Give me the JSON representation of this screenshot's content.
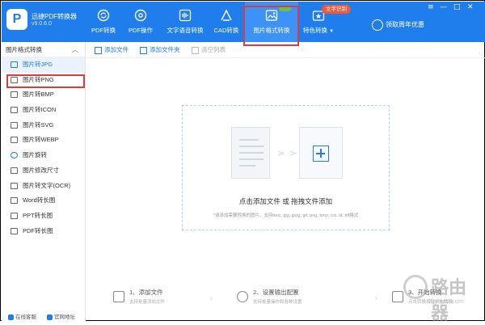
{
  "app": {
    "title": "迅捷PDF转换器",
    "version": "v9.0.6.0",
    "logo_letter": "P"
  },
  "nav": [
    {
      "label": "PDF转换",
      "icon": "refresh-icon"
    },
    {
      "label": "PDF操作",
      "icon": "disc-icon"
    },
    {
      "label": "文字语音转换",
      "icon": "audio-wave-icon"
    },
    {
      "label": "CAD转换",
      "icon": "cad-icon"
    },
    {
      "label": "图片格式转换",
      "icon": "image-icon"
    },
    {
      "label": "特色转换",
      "icon": "star-convert-icon"
    }
  ],
  "badges": {
    "ocr": "文字识别"
  },
  "promo": "领取周年优惠",
  "window_controls": [
    "≡",
    "—",
    "□",
    "✕"
  ],
  "sidebar": {
    "heading": "图片格式转换",
    "items": [
      "图片转JPG",
      "图片转PNG",
      "图片转BMP",
      "图片转ICON",
      "图片转SVG",
      "图片转WEBP",
      "图片旋转",
      "图片修改尺寸",
      "图片转文字(OCR)",
      "Word转长图",
      "PPT转长图",
      "PDF转长图"
    ],
    "active_index": 0,
    "footer": {
      "service": "在线客服",
      "website": "官网地址"
    }
  },
  "toolbar": {
    "add_file": "添加文件",
    "add_folder": "添加文件夹",
    "clear_list": "清空列表"
  },
  "dropzone": {
    "main_text": "点击添加文件 或 拖拽文件添加",
    "sub_text": "*请添加需要转换的图片，支持heic, jpg, jpeg, gif, png, bmp, ico, tif, tiff格式",
    "arrows": "> > >"
  },
  "steps": [
    {
      "title": "1、添加文件",
      "sub": "支持批量添加文件"
    },
    {
      "title": "2、设置输出配置",
      "sub": "支持批量操作和各种设置"
    },
    {
      "title": "3、开始转换",
      "sub": "点击转换按钮开始转换"
    }
  ],
  "watermark": {
    "text": "路由器",
    "url": "luyouqi.com"
  }
}
